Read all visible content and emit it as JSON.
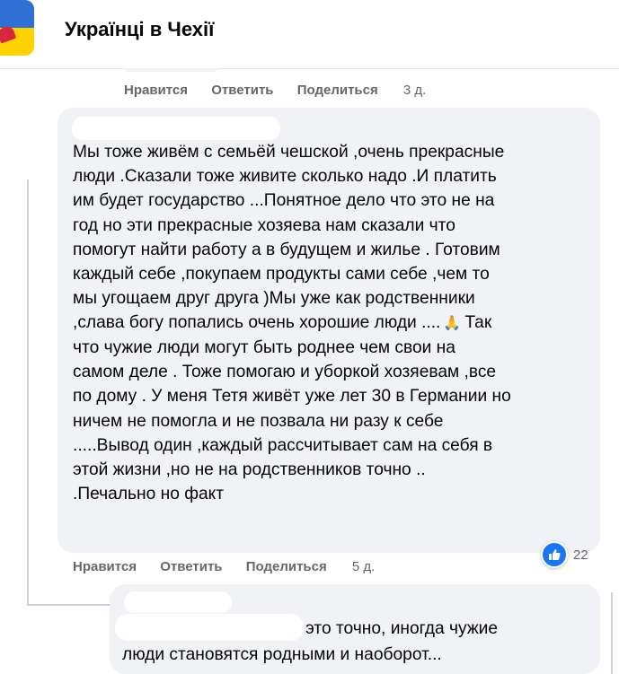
{
  "header": {
    "group_name": "Українці в Чехії"
  },
  "previous_comment": {
    "actions": {
      "like": "Нравится",
      "reply": "Ответить",
      "share": "Поделиться",
      "time": "3 д."
    }
  },
  "comment": {
    "lines": [
      "Мы тоже живём с семьёй чешской ,очень прекрасные",
      "люди .Сказали тоже живите сколько надо .И платить",
      "им будет государство ...Понятное дело что это не на",
      "год но эти прекрасные хозяева нам сказали что",
      "помогут найти работу а в будущем и жилье . Готовим",
      "каждый себе ,покупаем продукты сами себе ,чем то",
      "мы угощаем друг друга )Мы уже как родственники",
      ",слава богу попались очень хорошие люди ....",
      "Так",
      "что чужие люди могут быть роднее чем свои на",
      "самом деле . Тоже помогаю и уборкой хозяевам ,все",
      "по дому . У меня Тетя живёт уже лет 30 в Германии но",
      "ничем не помогла и не позвала ни разу к себе",
      ".....Вывод один ,каждый рассчитывает сам на себя в",
      "этой жизни ,но не на родственников точно ..",
      ".Печально но факт"
    ],
    "emoji": "🙏",
    "reactions": {
      "icon": "thumbs-up",
      "count": "22",
      "color": "#1877f2"
    },
    "actions": {
      "like": "Нравится",
      "reply": "Ответить",
      "share": "Поделиться",
      "time": "5 д."
    }
  },
  "reply": {
    "lines": [
      "это точно, иногда чужие",
      "люди становятся родными и наоборот..."
    ]
  }
}
